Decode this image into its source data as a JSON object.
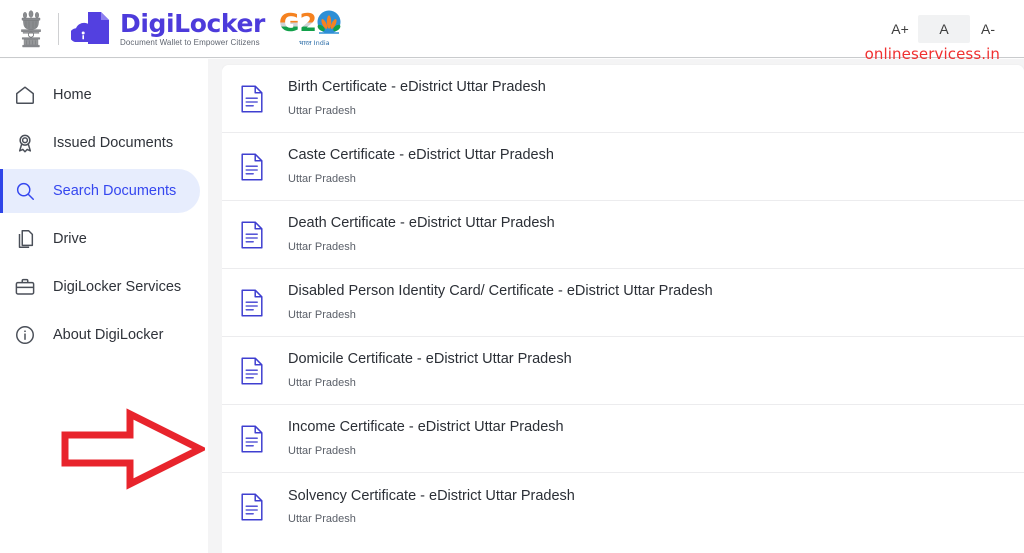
{
  "header": {
    "emblem_icon": "india-national-emblem",
    "brand": {
      "mark_icon": "digilocker-cloud-document-icon",
      "name": "DigiLocker",
      "tagline": "Document Wallet to Empower Citizens"
    },
    "g20": {
      "icon": "g20-india-logo",
      "text": "G20",
      "sublabel": "भारत  India"
    },
    "font_size_controls": [
      {
        "label": "A+",
        "name": "font-increase-button",
        "selected": false
      },
      {
        "label": "A",
        "name": "font-normal-button",
        "selected": true
      },
      {
        "label": "A-",
        "name": "font-decrease-button",
        "selected": false
      }
    ]
  },
  "watermark": {
    "text": "onlineservicess.in",
    "color": "#f03030"
  },
  "annotation": {
    "arrow_color": "#e8242c",
    "arrow_direction": "right"
  },
  "sidebar": {
    "active_bg": "#e7edfd",
    "active_color": "#3547ef",
    "items": [
      {
        "label": "Home",
        "icon": "home-icon",
        "active": false
      },
      {
        "label": "Issued Documents",
        "icon": "award-ribbon-icon",
        "active": false
      },
      {
        "label": "Search Documents",
        "icon": "search-icon",
        "active": true
      },
      {
        "label": "Drive",
        "icon": "stacked-files-icon",
        "active": false
      },
      {
        "label": "DigiLocker Services",
        "icon": "briefcase-icon",
        "active": false
      },
      {
        "label": "About DigiLocker",
        "icon": "info-circle-icon",
        "active": false
      }
    ]
  },
  "main": {
    "documents": [
      {
        "title": "Birth Certificate - eDistrict Uttar Pradesh",
        "issuer": "Uttar Pradesh",
        "icon": "document-icon"
      },
      {
        "title": "Caste Certificate - eDistrict Uttar Pradesh",
        "issuer": "Uttar Pradesh",
        "icon": "document-icon"
      },
      {
        "title": "Death Certificate - eDistrict Uttar Pradesh",
        "issuer": "Uttar Pradesh",
        "icon": "document-icon"
      },
      {
        "title": "Disabled Person Identity Card/ Certificate - eDistrict Uttar Pradesh",
        "issuer": "Uttar Pradesh",
        "icon": "document-icon"
      },
      {
        "title": "Domicile Certificate - eDistrict Uttar Pradesh",
        "issuer": "Uttar Pradesh",
        "icon": "document-icon"
      },
      {
        "title": "Income Certificate - eDistrict Uttar Pradesh",
        "issuer": "Uttar Pradesh",
        "icon": "document-icon"
      },
      {
        "title": "Solvency Certificate - eDistrict Uttar Pradesh",
        "issuer": "Uttar Pradesh",
        "icon": "document-icon"
      }
    ]
  }
}
